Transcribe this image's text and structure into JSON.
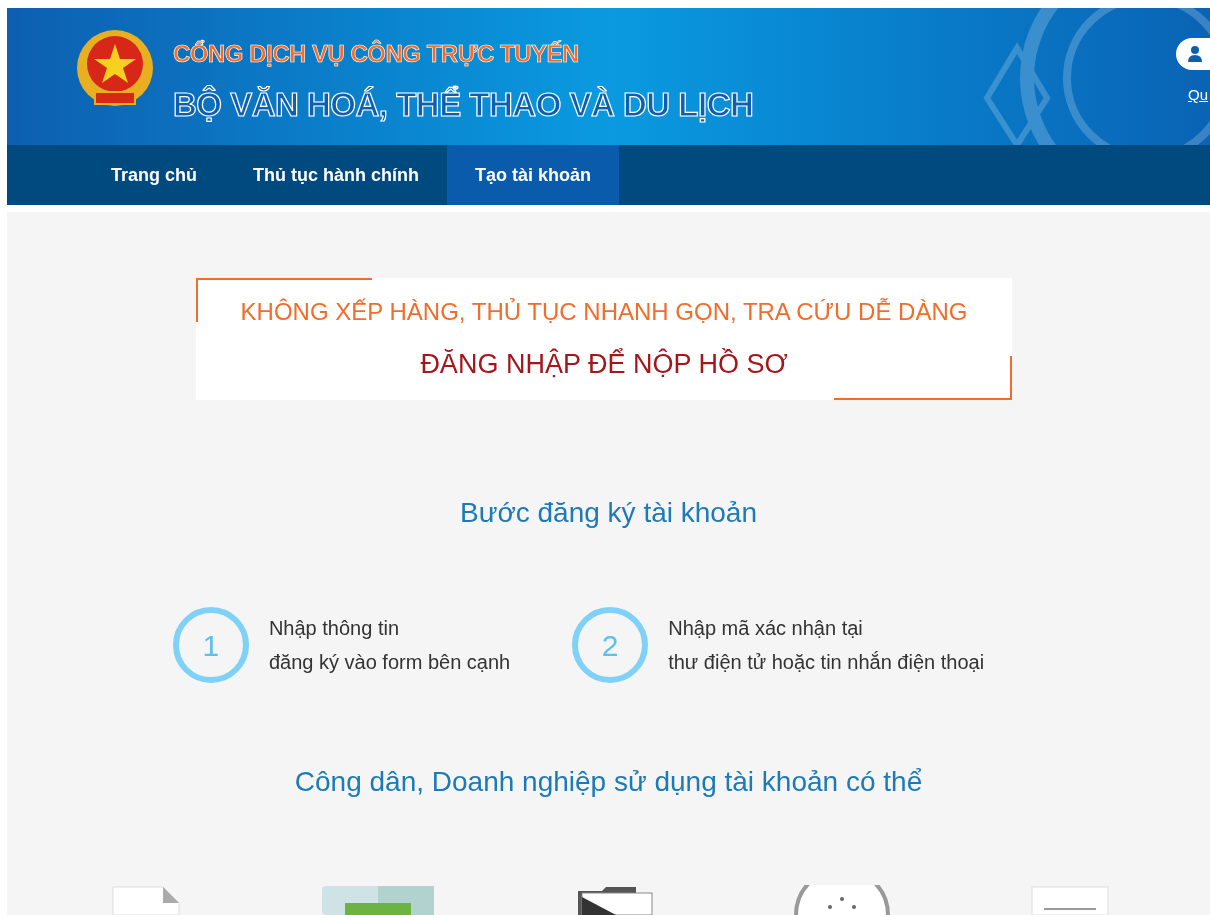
{
  "header": {
    "subtitle": "CỔNG DỊCH VỤ CÔNG TRỰC TUYẾN",
    "title": "BỘ VĂN HOÁ, THỂ THAO VÀ DU LỊCH",
    "login_link": "Qu"
  },
  "nav": [
    {
      "label": "Trang chủ",
      "selected": false
    },
    {
      "label": "Thủ tục hành chính",
      "selected": false
    },
    {
      "label": "Tạo tài khoản",
      "selected": true
    }
  ],
  "banner": {
    "slogan": "KHÔNG XẾP HÀNG, THỦ TỤC NHANH GỌN, TRA CỨU DỄ DÀNG",
    "headline": "ĐĂNG NHẬP ĐỂ NỘP HỒ SƠ"
  },
  "steps_title": "Bước đăng ký tài khoản",
  "steps": [
    {
      "number": "1",
      "lines": [
        "Nhập thông tin",
        "đăng ký vào form bên cạnh"
      ]
    },
    {
      "number": "2",
      "lines": [
        "Nhập mã xác nhận tại",
        "thư điện tử hoặc tin nhắn điện thoại"
      ]
    }
  ],
  "benefits_title": "Công dân, Doanh nghiệp sử dụng tài khoản có thể",
  "benefit_icons": [
    {
      "kind": "document"
    },
    {
      "kind": "screen"
    },
    {
      "kind": "folder"
    },
    {
      "kind": "clock"
    },
    {
      "kind": "form"
    }
  ]
}
